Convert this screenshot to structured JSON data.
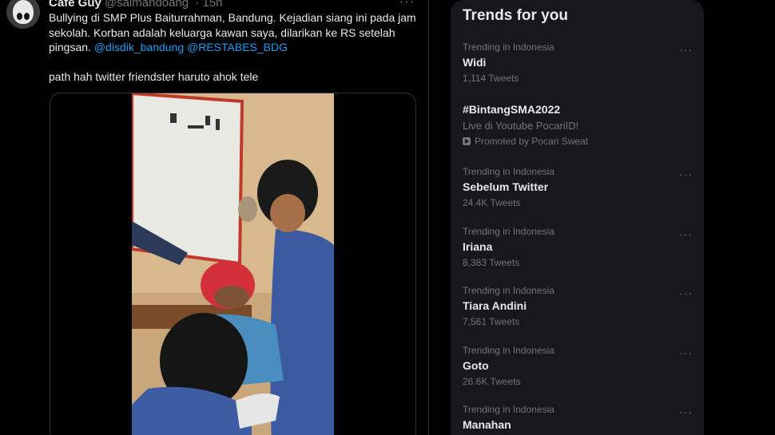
{
  "tweet": {
    "name": "Cafe Guy",
    "handle": "@salmandoang",
    "time": "· 15h",
    "text_line": "Bullying di SMP Plus Baiturrahman, Bandung. Kejadian siang ini pada jam sekolah. Korban adalah keluarga kawan saya, dilarikan ke RS setelah pingsan.",
    "mention1": "@disdik_bandung",
    "mention2": "@RESTABES_BDG",
    "text_line2": "path hah twitter friendster haruto ahok tele",
    "more": "···"
  },
  "trends": {
    "title": "Trends for you",
    "items": [
      {
        "context": "Trending in Indonesia",
        "name": "Widi",
        "count": "1,114 Tweets"
      },
      {
        "name": "#BintangSMA2022",
        "description": "Live di Youtube PocariID!",
        "promoted": "Promoted by Pocari Sweat"
      },
      {
        "context": "Trending in Indonesia",
        "name": "Sebelum Twitter",
        "count": "24.4K Tweets"
      },
      {
        "context": "Trending in Indonesia",
        "name": "Iriana",
        "count": "8,383 Tweets"
      },
      {
        "context": "Trending in Indonesia",
        "name": "Tiara Andini",
        "count": "7,561 Tweets"
      },
      {
        "context": "Trending in Indonesia",
        "name": "Goto",
        "count": "26.6K Tweets"
      },
      {
        "context": "Trending in Indonesia",
        "name": "Manahan",
        "count": ""
      }
    ]
  },
  "colors": {
    "accent": "#1d9bf0",
    "muted": "#71767b",
    "panel": "#16181c"
  }
}
